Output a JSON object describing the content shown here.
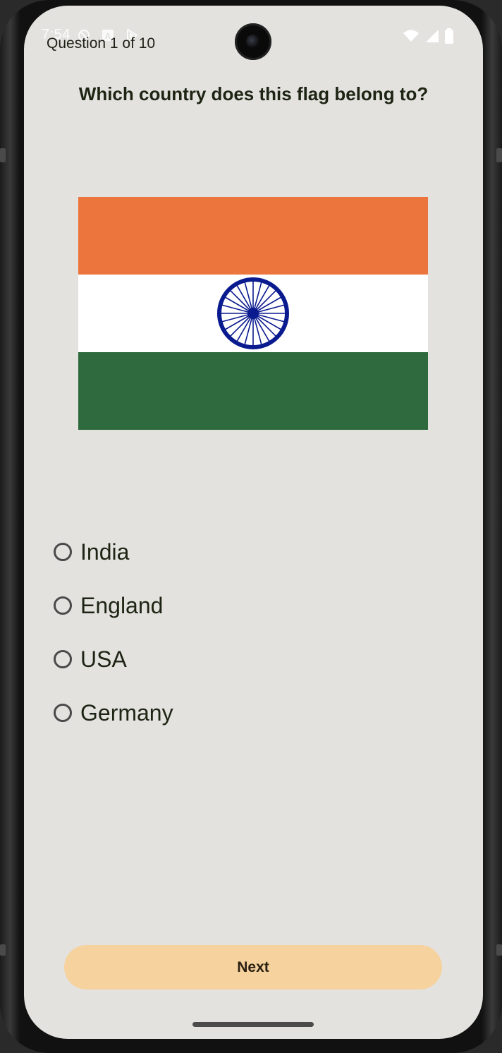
{
  "status_bar": {
    "time": "7:54",
    "left_icons": [
      "do-not-disturb-icon",
      "a-notification-icon",
      "play-store-icon"
    ],
    "right_icons": [
      "wifi-icon",
      "signal-icon",
      "battery-icon"
    ]
  },
  "quiz": {
    "progress_text": "Question 1 of 10",
    "question": "Which country does this flag belong to?",
    "flag": {
      "name": "india-flag",
      "colors": {
        "saffron": "#ec753d",
        "white": "#ffffff",
        "green": "#2e6a3e",
        "chakra": "#0a1a8f"
      }
    },
    "options": [
      {
        "label": "India",
        "selected": false
      },
      {
        "label": "England",
        "selected": false
      },
      {
        "label": "USA",
        "selected": false
      },
      {
        "label": "Germany",
        "selected": false
      }
    ],
    "next_label": "Next"
  },
  "colors": {
    "background": "#e3e2df",
    "button": "#f6d29e",
    "text": "#1d2413"
  }
}
